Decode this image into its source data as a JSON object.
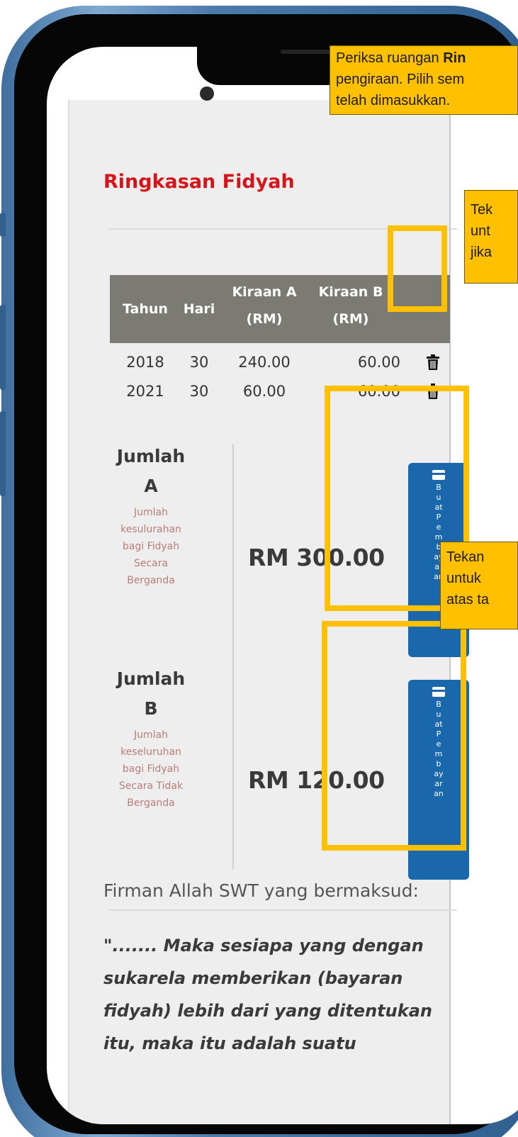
{
  "summary": {
    "title": "Ringkasan Fidyah",
    "table": {
      "headers": [
        {
          "line1": "Tahun",
          "line2": ""
        },
        {
          "line1": "Hari",
          "line2": ""
        },
        {
          "line1": "Kiraan A",
          "line2": "(RM)"
        },
        {
          "line1": "Kiraan B",
          "line2": "(RM)"
        }
      ],
      "rows": [
        {
          "tahun": "2018",
          "hari": "30",
          "kiraan_a": "240.00",
          "kiraan_b": "60.00"
        },
        {
          "tahun": "2021",
          "hari": "30",
          "kiraan_a": "60.00",
          "kiraan_b": "60.00"
        }
      ],
      "delete_icon": "trash-icon"
    }
  },
  "totals": [
    {
      "title_line1": "Jumlah",
      "title_line2": "A",
      "desc_lines": [
        "Jumlah",
        "kesulurahan",
        "bagi Fidyah",
        "Secara",
        "Berganda"
      ],
      "amount": "RM 300.00",
      "pay_icon": "credit-card-icon",
      "pay_lines": [
        "B",
        "u",
        "at",
        "P",
        "e",
        "m",
        "b",
        "ay",
        "ar",
        "an"
      ]
    },
    {
      "title_line1": "Jumlah",
      "title_line2": "B",
      "desc_lines": [
        "Jumlah",
        "keseluruhan",
        "bagi Fidyah",
        "Secara Tidak",
        "Berganda"
      ],
      "amount": "RM 120.00",
      "pay_icon": "credit-card-icon",
      "pay_lines": [
        "B",
        "u",
        "at",
        "P",
        "e",
        "m",
        "b",
        "ay",
        "ar",
        "an"
      ]
    }
  ],
  "quote": {
    "intro": "Firman Allah SWT yang bermaksud:",
    "lines": [
      "\"....... Maka sesiapa yang dengan",
      "sukarela memberikan (bayaran",
      "fidyah) lebih dari yang ditentukan",
      "itu, maka itu adalah suatu"
    ]
  },
  "annotations": {
    "callout_top": {
      "line1_pre": "Periksa ruangan ",
      "line1_bold": "Rin",
      "line2": "pengiraan. Pilih sem",
      "line3": "telah dimasukkan."
    },
    "callout_delete": {
      "line1": "Tek",
      "line2": "unt",
      "line3": "jika"
    },
    "callout_pay": {
      "line1": "Tekan",
      "line2": "untuk",
      "line3": "atas ta"
    },
    "highlight_color": "#ffc000"
  },
  "colors": {
    "title": "#d6151b",
    "table_header": "#7b7b73",
    "pay_button": "#1a67ab",
    "description": "#b87d78"
  }
}
